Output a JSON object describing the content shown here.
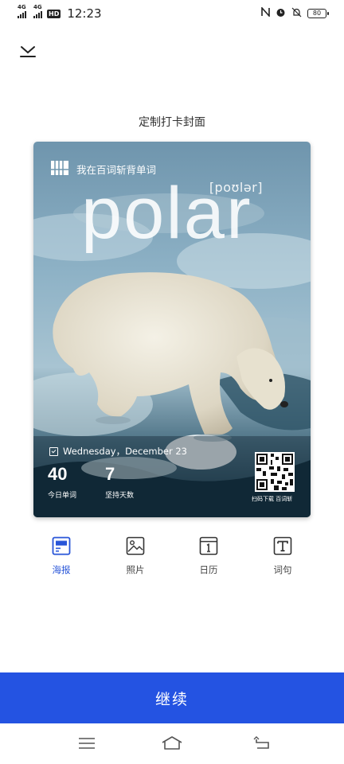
{
  "status": {
    "signal1": "4G",
    "signal2": "4G",
    "hd": "HD",
    "time": "12:23",
    "battery": "80",
    "icons": [
      "nfc-icon",
      "alarm-icon",
      "mute-icon",
      "battery-icon"
    ]
  },
  "page": {
    "title": "定制打卡封面"
  },
  "poster": {
    "app_text": "我在百词斩背单词",
    "phonetic": "[poʊlər]",
    "word": "polar",
    "date": "Wednesday，December 23",
    "stats": [
      {
        "value": "40",
        "label": "今日单词"
      },
      {
        "value": "7",
        "label": "坚持天数"
      }
    ],
    "qr_caption": "扫码下载 百词斩"
  },
  "tabs": [
    {
      "label": "海报",
      "icon": "poster-icon",
      "active": true
    },
    {
      "label": "照片",
      "icon": "photo-icon",
      "active": false
    },
    {
      "label": "日历",
      "icon": "calendar-icon",
      "active": false
    },
    {
      "label": "词句",
      "icon": "text-icon",
      "active": false
    }
  ],
  "colors": {
    "accent": "#2453e2",
    "active_tab": "#2855d8"
  },
  "continue_label": "继续",
  "nav": [
    "menu-icon",
    "home-icon",
    "back-icon"
  ]
}
